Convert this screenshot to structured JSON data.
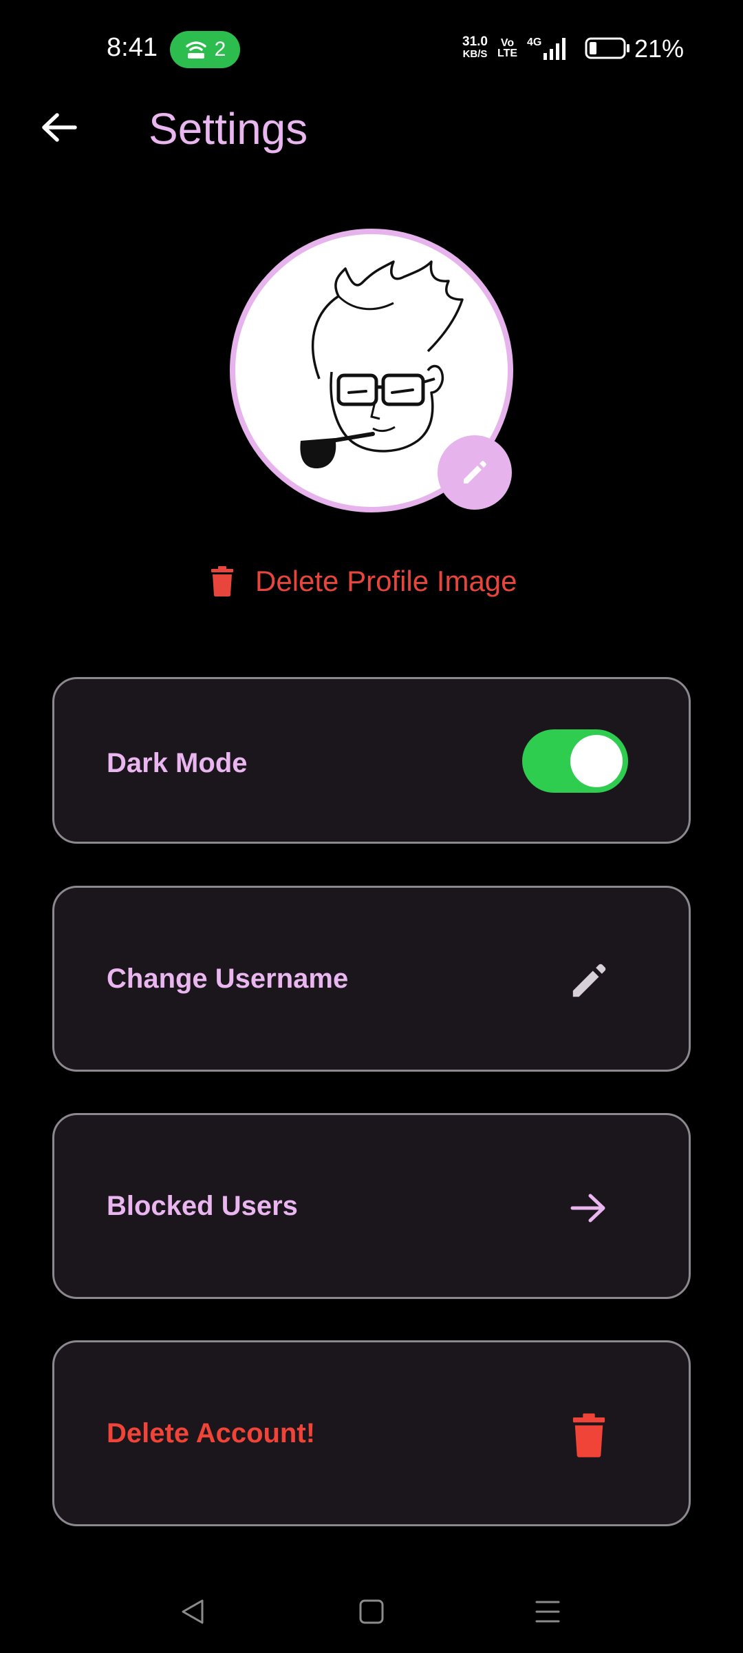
{
  "status_bar": {
    "time": "8:41",
    "hotspot_count": "2",
    "net_speed_value": "31.0",
    "net_speed_unit": "KB/S",
    "volte_top": "Vo",
    "volte_bottom": "LTE",
    "network_type": "4G",
    "battery_percent": "21%"
  },
  "app_bar": {
    "title": "Settings"
  },
  "profile": {
    "delete_image_label": "Delete Profile Image"
  },
  "settings": {
    "dark_mode_label": "Dark Mode",
    "dark_mode_on": true,
    "change_username_label": "Change Username",
    "blocked_users_label": "Blocked Users",
    "delete_account_label": "Delete Account!"
  },
  "colors": {
    "accent": "#e9b6ef",
    "danger": "#f04438",
    "toggle_on": "#2ecc4f",
    "card_bg": "#1a161b"
  },
  "icons": [
    "back-arrow-icon",
    "edit-pencil-icon",
    "trash-icon",
    "arrow-right-icon",
    "hotspot-icon",
    "signal-icon",
    "battery-icon"
  ]
}
